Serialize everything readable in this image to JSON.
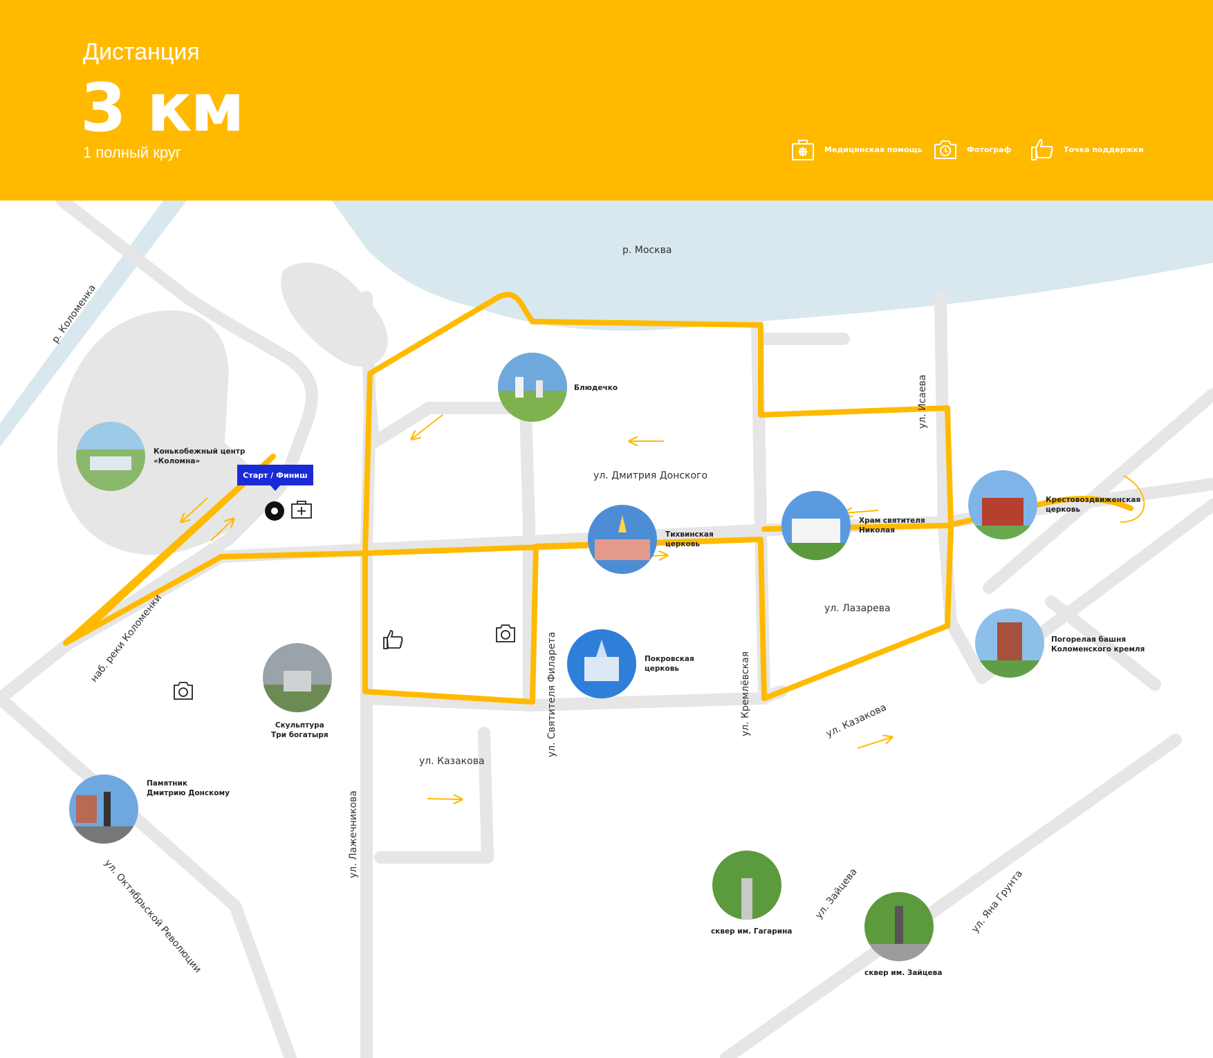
{
  "header": {
    "title": "Дистанция",
    "distance": "3 км",
    "laps": "1 полный круг"
  },
  "legend": {
    "medical": "Медицинская помощь",
    "photo": "Фотограф",
    "support": "Точка поддержки"
  },
  "start_finish": "Старт / Финиш",
  "colors": {
    "header": "#FFBA00",
    "route": "#FFBA00",
    "roads": "#E6E6E6",
    "river": "#D9E8EE",
    "start_marker": "#1A2BD6"
  },
  "map": {
    "water": {
      "moskva": "р. Москва",
      "kolomenka": "р. Коломенка"
    },
    "streets": {
      "donskogo": "ул. Дмитрия Донского",
      "isaeva": "ул. Исаева",
      "lazareva": "ул. Лазарева",
      "kazakova_right": "ул. Казакова",
      "kazakova_left": "ул. Казакова",
      "filareta": "ул. Святителя Филарета",
      "kremlevskaya": "ул. Кремлёвская",
      "lazhechnikova": "ул. Лажечникова",
      "naberezhnaya": "наб. реки Коломенки",
      "oktyabrskoy": "ул. Октябрьской Революции",
      "zaytseva": "ул. Зайцева",
      "yana_grunta": "ул. Яна Грунта"
    },
    "landmarks": {
      "skating": "Конькобежный центр\n«Коломна»",
      "bludechko": "Блюдечко",
      "tikhvinskaya": "Тихвинская\nцерковь",
      "nikolaya": "Храм святителя\nНиколая",
      "krestovozdvizhenskaya": "Крестовоздвиженская\nцерковь",
      "pogorelaya": "Погорелая башня\nКоломенского кремля",
      "pokrovskaya": "Покровская\nцерковь",
      "bogatyri": "Скульптура\nТри богатыря",
      "donskomu": "Памятник\nДмитрию Донскому",
      "gagarina": "сквер им. Гагарина",
      "zaytseva_sq": "сквер им. Зайцева"
    }
  }
}
